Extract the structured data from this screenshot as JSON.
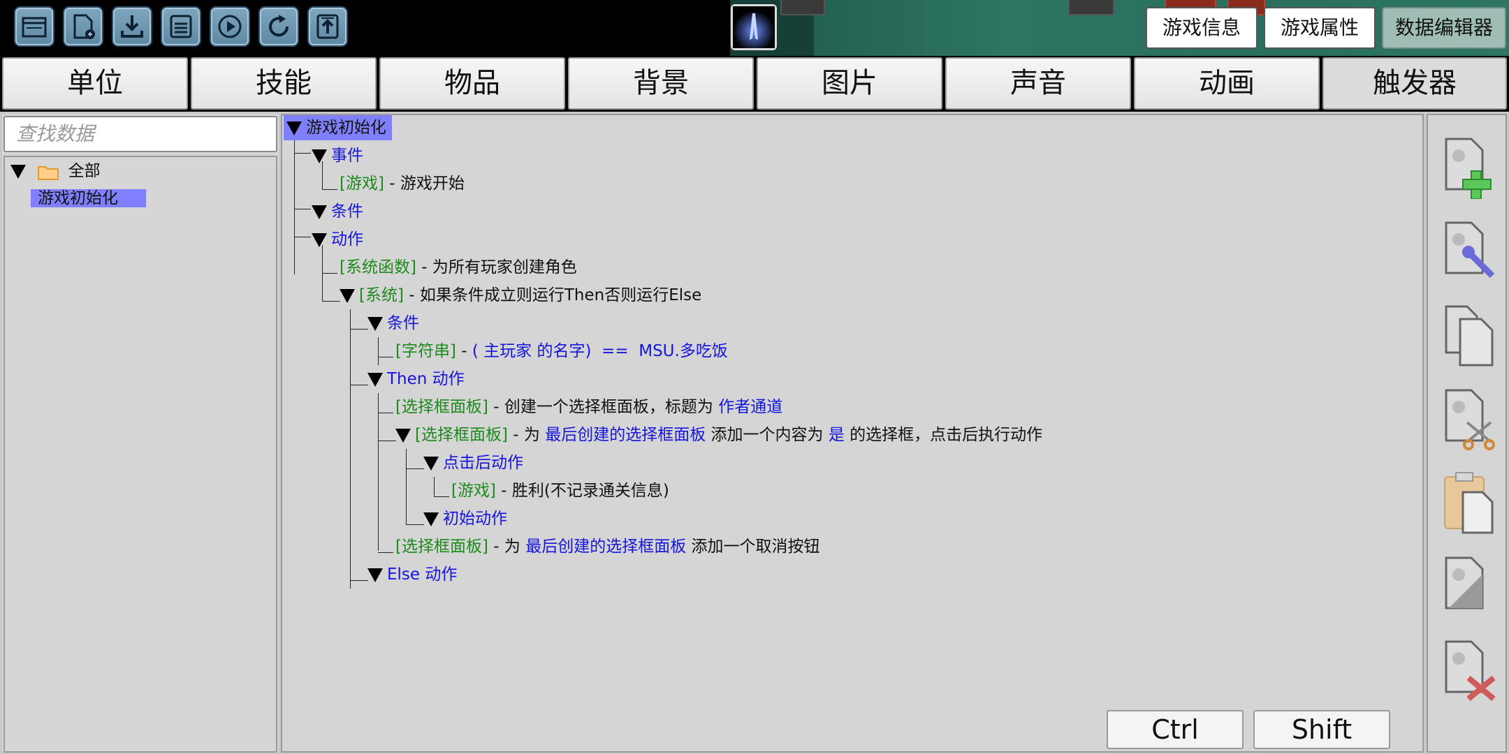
{
  "toolbar": {
    "buttons": [
      "open-folder-icon",
      "new-file-icon",
      "download-icon",
      "save-icon",
      "play-icon",
      "refresh-icon",
      "upload-icon"
    ],
    "right_buttons": [
      {
        "label": "游戏信息",
        "active": false
      },
      {
        "label": "游戏属性",
        "active": false
      },
      {
        "label": "数据编辑器",
        "active": true
      }
    ]
  },
  "tabs": [
    "单位",
    "技能",
    "物品",
    "背景",
    "图片",
    "声音",
    "动画",
    "触发器"
  ],
  "active_tab": "触发器",
  "left": {
    "search_placeholder": "查找数据",
    "folder_label": "全部",
    "selected_item": "游戏初始化"
  },
  "trigger": {
    "root": "游戏初始化",
    "events_label": "事件",
    "event1": {
      "tag": "[游戏]",
      "text": " - 游戏开始"
    },
    "conditions_label": "条件",
    "actions_label": "动作",
    "a1": {
      "tag": "[系统函数]",
      "text": " - 为所有玩家创建角色"
    },
    "a2": {
      "tag": "[系统]",
      "text": " - 如果条件成立则运行Then否则运行Else"
    },
    "a2_cond_label": "条件",
    "a2_cond1": {
      "tag": "[字符串]",
      "sep": " - ",
      "expr": "( 主玩家 的名字)  ==  MSU.多吃饭"
    },
    "then_label": "Then 动作",
    "t1": {
      "tag": "[选择框面板]",
      "text": " - 创建一个选择框面板，标题为 ",
      "val": "作者通道"
    },
    "t2": {
      "tag": "[选择框面板]",
      "p1": " - 为 ",
      "v1": "最后创建的选择框面板",
      "p2": " 添加一个内容为 ",
      "v2": "是",
      "p3": " 的选择框，点击后执行动作"
    },
    "click_label": "点击后动作",
    "c1": {
      "tag": "[游戏]",
      "text": " - 胜利(不记录通关信息)"
    },
    "init_label": "初始动作",
    "t3": {
      "tag": "[选择框面板]",
      "p1": " - 为 ",
      "v1": "最后创建的选择框面板",
      "p2": " 添加一个取消按钮"
    },
    "else_label": "Else 动作"
  },
  "side_icons": [
    "add-trigger-icon",
    "edit-trigger-icon",
    "copy-icon",
    "cut-icon",
    "paste-icon",
    "disable-icon",
    "delete-icon"
  ],
  "keys": {
    "ctrl": "Ctrl",
    "shift": "Shift"
  },
  "colors": {
    "selection": "#8080ff",
    "keyword": "#1515dd",
    "tag": "#1d8a1d"
  }
}
